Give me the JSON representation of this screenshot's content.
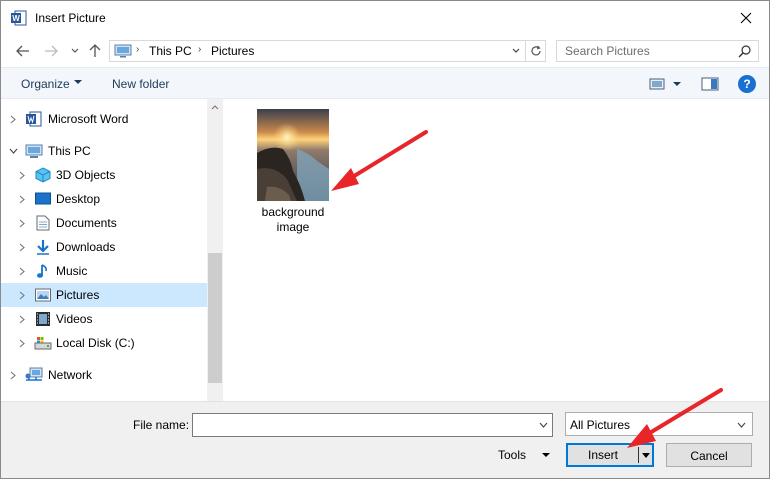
{
  "window": {
    "title": "Insert Picture",
    "app_icon_letter": "W"
  },
  "address": {
    "crumbs": [
      "This PC",
      "Pictures"
    ]
  },
  "search": {
    "placeholder": "Search Pictures"
  },
  "toolbar": {
    "organize_label": "Organize",
    "new_folder_label": "New folder",
    "help_label": "?"
  },
  "nav_tree": {
    "items": [
      {
        "label": "Microsoft Word",
        "icon": "word-icon"
      },
      {
        "label": "This PC",
        "icon": "pc-icon"
      },
      {
        "label": "3D Objects",
        "icon": "3d-objects-icon"
      },
      {
        "label": "Desktop",
        "icon": "desktop-icon"
      },
      {
        "label": "Documents",
        "icon": "documents-icon"
      },
      {
        "label": "Downloads",
        "icon": "downloads-icon"
      },
      {
        "label": "Music",
        "icon": "music-icon"
      },
      {
        "label": "Pictures",
        "icon": "pictures-icon",
        "selected": true
      },
      {
        "label": "Videos",
        "icon": "videos-icon"
      },
      {
        "label": "Local Disk (C:)",
        "icon": "local-disk-icon"
      },
      {
        "label": "Network",
        "icon": "network-icon"
      }
    ]
  },
  "files": [
    {
      "name_line1": "background",
      "name_line2": "image"
    }
  ],
  "bottom": {
    "file_name_label": "File name:",
    "file_name_value": "",
    "file_type_value": "All Pictures",
    "tools_label": "Tools",
    "insert_label": "Insert",
    "cancel_label": "Cancel"
  },
  "colors": {
    "selection": "#cce8ff",
    "accent": "#0078d7",
    "arrow": "#e8262a",
    "help": "#1a6fd1"
  }
}
